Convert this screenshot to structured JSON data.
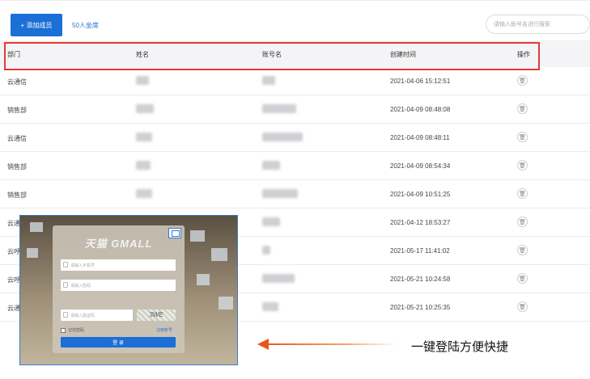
{
  "toolbar": {
    "add_button_label": "+ 添加成员",
    "seat_link": "50人坐席",
    "search_placeholder": "请输入账号名进行搜索"
  },
  "table": {
    "headers": {
      "dept": "部门",
      "name": "姓名",
      "account": "账号名",
      "created": "创建时间",
      "action": "操作"
    },
    "rows": [
      {
        "dept": "云通信",
        "created": "2021-04-06 15:12:51"
      },
      {
        "dept": "销售部",
        "created": "2021-04-09 08:48:08"
      },
      {
        "dept": "云通信",
        "created": "2021-04-09 08:48:11"
      },
      {
        "dept": "销售部",
        "created": "2021-04-09 08:54:34"
      },
      {
        "dept": "销售部",
        "created": "2021-04-09 10:51:25"
      },
      {
        "dept": "云通",
        "created": "2021-04-12 18:53:27"
      },
      {
        "dept": "云呼",
        "created": "2021-05-17 11:41:02"
      },
      {
        "dept": "云呼",
        "created": "2021-05-21 10:24:58"
      },
      {
        "dept": "云通",
        "created": "2021-05-21 10:25:35"
      }
    ]
  },
  "login": {
    "brand": "天猫 GMALL",
    "username_placeholder": "请输入手机号",
    "password_placeholder": "请输入密码",
    "captcha_placeholder": "请输入验证码",
    "captcha_text": "3WE",
    "remember_label": "记住密码",
    "register_link": "注册账号",
    "submit_label": "登 录"
  },
  "caption": "一键登陆方便快捷",
  "colors": {
    "primary": "#1b6fd6",
    "highlight": "#e53935",
    "arrow": "#e8561a"
  }
}
